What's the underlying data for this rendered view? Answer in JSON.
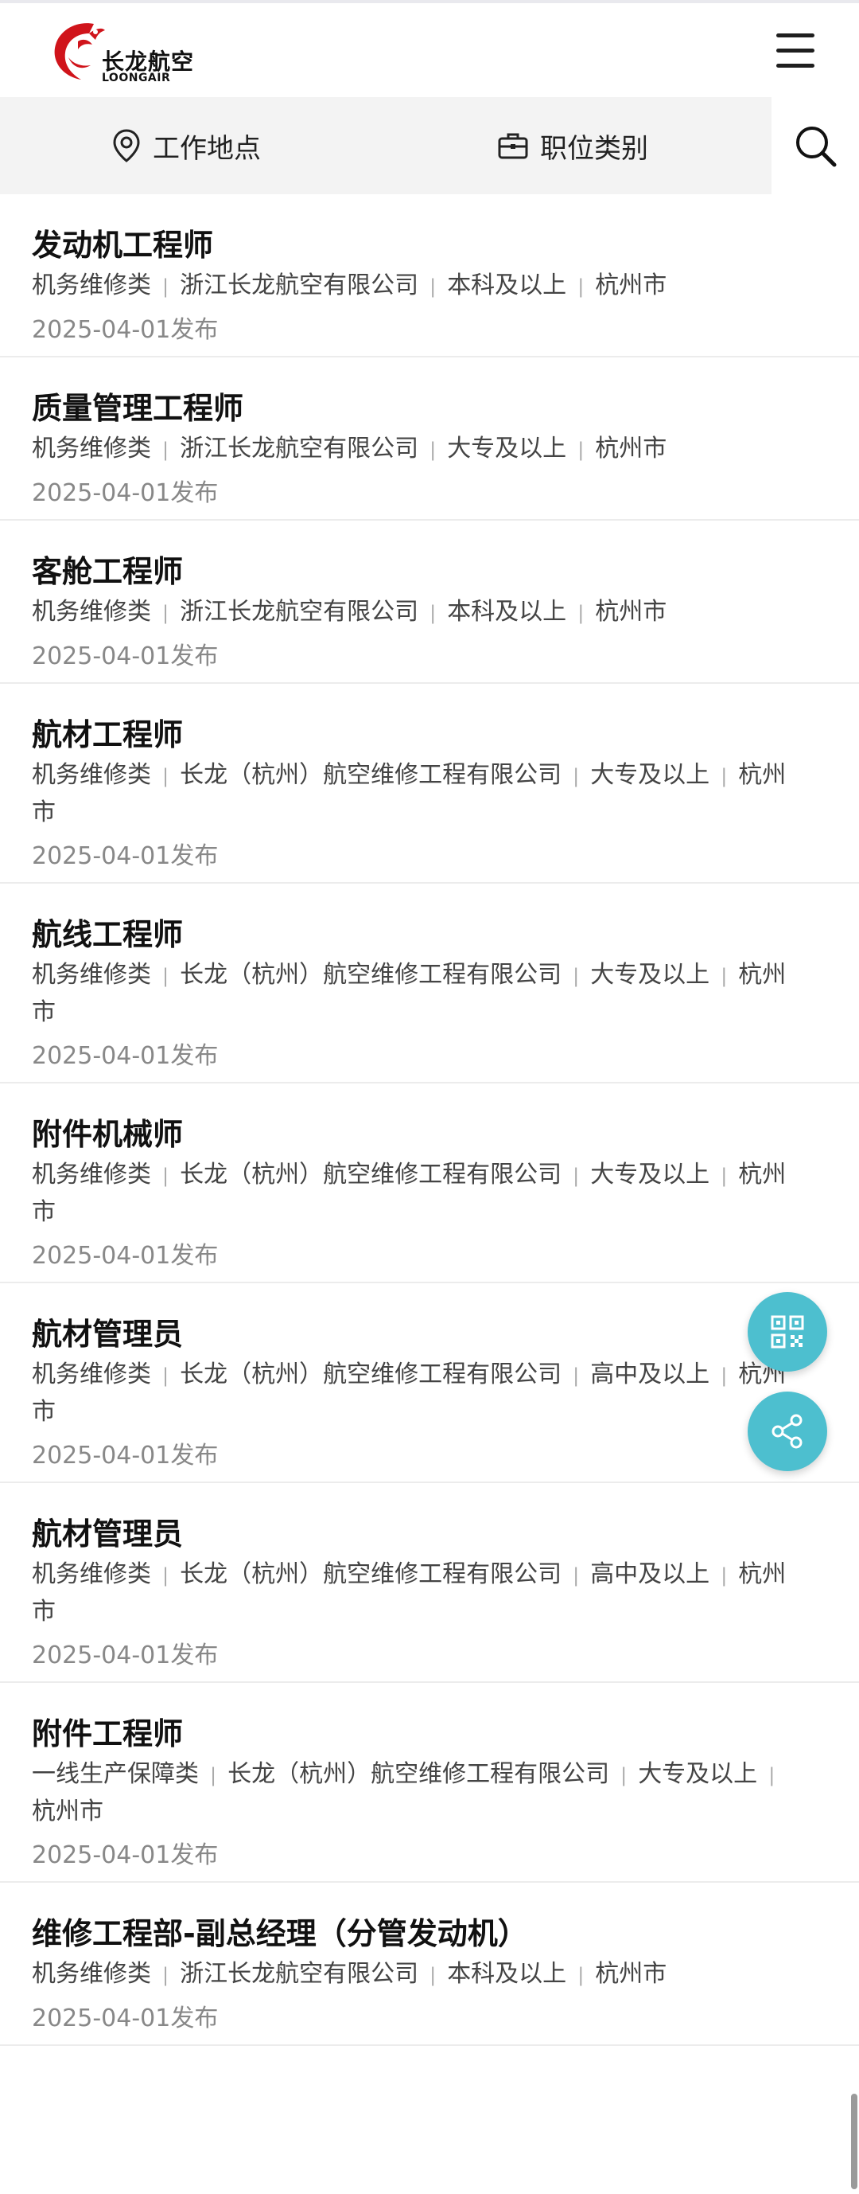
{
  "brand": {
    "name_cn": "长龙航空",
    "name_en": "LOONGAIR",
    "color": "#d0141b"
  },
  "header": {
    "menu_icon": "menu-icon"
  },
  "filters": {
    "location": {
      "label": "工作地点",
      "icon": "location-pin-icon"
    },
    "category": {
      "label": "职位类别",
      "icon": "briefcase-icon"
    },
    "search_icon": "search-icon"
  },
  "colors": {
    "accent": "#4dbfcf",
    "filter_bg": "#f3f3f3"
  },
  "jobs": [
    {
      "title": "发动机工程师",
      "meta": [
        "机务维修类",
        "浙江长龙航空有限公司",
        "本科及以上",
        "杭州市"
      ],
      "date": "2025-04-01发布"
    },
    {
      "title": "质量管理工程师",
      "meta": [
        "机务维修类",
        "浙江长龙航空有限公司",
        "大专及以上",
        "杭州市"
      ],
      "date": "2025-04-01发布"
    },
    {
      "title": "客舱工程师",
      "meta": [
        "机务维修类",
        "浙江长龙航空有限公司",
        "本科及以上",
        "杭州市"
      ],
      "date": "2025-04-01发布"
    },
    {
      "title": "航材工程师",
      "meta": [
        "机务维修类",
        "长龙（杭州）航空维修工程有限公司",
        "大专及以上",
        "杭州市"
      ],
      "date": "2025-04-01发布"
    },
    {
      "title": "航线工程师",
      "meta": [
        "机务维修类",
        "长龙（杭州）航空维修工程有限公司",
        "大专及以上",
        "杭州市"
      ],
      "date": "2025-04-01发布"
    },
    {
      "title": "附件机械师",
      "meta": [
        "机务维修类",
        "长龙（杭州）航空维修工程有限公司",
        "大专及以上",
        "杭州市"
      ],
      "date": "2025-04-01发布"
    },
    {
      "title": "航材管理员",
      "meta": [
        "机务维修类",
        "长龙（杭州）航空维修工程有限公司",
        "高中及以上",
        "杭州市"
      ],
      "date": "2025-04-01发布"
    },
    {
      "title": "航材管理员",
      "meta": [
        "机务维修类",
        "长龙（杭州）航空维修工程有限公司",
        "高中及以上",
        "杭州市"
      ],
      "date": "2025-04-01发布"
    },
    {
      "title": "附件工程师",
      "meta": [
        "一线生产保障类",
        "长龙（杭州）航空维修工程有限公司",
        "大专及以上",
        "杭州市"
      ],
      "date": "2025-04-01发布"
    },
    {
      "title": "维修工程部-副总经理（分管发动机）",
      "meta": [
        "机务维修类",
        "浙江长龙航空有限公司",
        "本科及以上",
        "杭州市"
      ],
      "date": "2025-04-01发布"
    }
  ],
  "fabs": {
    "qr_icon": "qr-code-icon",
    "share_icon": "share-icon"
  }
}
